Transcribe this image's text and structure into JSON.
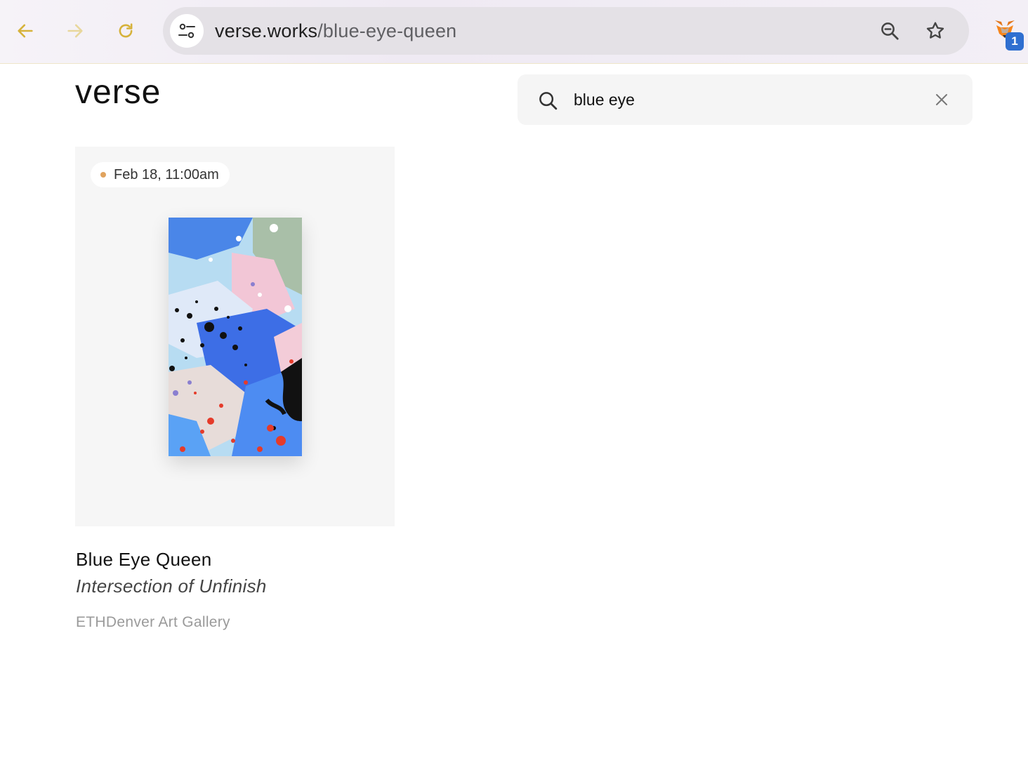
{
  "browser": {
    "url_host": "verse.works",
    "url_path": "/blue-eye-queen",
    "extension_badge": "1",
    "accent_color": "#d6b23a",
    "icons": [
      "back-arrow-icon",
      "forward-arrow-icon",
      "reload-icon",
      "site-settings-icon",
      "zoom-out-icon",
      "bookmark-star-icon",
      "metamask-fox-icon"
    ]
  },
  "header": {
    "logo": "verse"
  },
  "search": {
    "value": "blue eye",
    "icon": "search-icon",
    "clear_icon": "close-icon"
  },
  "result": {
    "date": "Feb 18, 11:00am",
    "date_dot_color": "#e0a35e",
    "title": "Blue Eye Queen",
    "subtitle": "Intersection of Unfinish",
    "gallery": "ETHDenver Art Gallery"
  }
}
